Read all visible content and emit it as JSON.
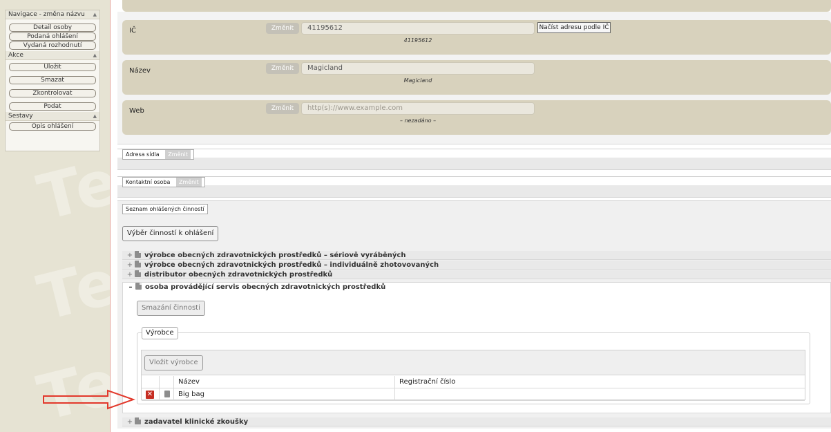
{
  "sidebar": {
    "navigation": {
      "header": "Navigace - změna názvu",
      "items": [
        "Detail osoby",
        "Podaná ohlášení",
        "Vydaná rozhodnutí"
      ]
    },
    "actions": {
      "header": "Akce",
      "items": [
        "Uložit",
        "Smazat",
        "Zkontrolovat",
        "Podat"
      ]
    },
    "reports": {
      "header": "Sestavy",
      "items": [
        "Opis ohlášení"
      ]
    },
    "watermark": "Tes"
  },
  "fields": [
    {
      "label": "IČ",
      "change": "Změnit",
      "value": "41195612",
      "placeholder": "",
      "display": "41195612"
    },
    {
      "label": "Název",
      "change": "Změnit",
      "value": "Magicland",
      "placeholder": "",
      "display": "Magicland"
    },
    {
      "label": "Web",
      "change": "Změnit",
      "value": "",
      "placeholder": "http(s)://www.example.com",
      "display": "– nezadáno –"
    }
  ],
  "load_address_button": "Načíst adresu podle IČ",
  "sections": {
    "seat_address": {
      "legend": "Adresa sídla",
      "change": "Změnit"
    },
    "contact_person": {
      "legend": "Kontaktní osoba",
      "change": "Změnit"
    },
    "activities": {
      "legend": "Seznam ohlášených činností",
      "select_button": "Výběr činností k ohlášení",
      "items": [
        {
          "sign": "+",
          "label": "výrobce obecných zdravotnických prostředků – sériově vyráběných"
        },
        {
          "sign": "+",
          "label": "výrobce obecných zdravotnických prostředků – individuálně zhotovovaných"
        },
        {
          "sign": "+",
          "label": "distributor obecných zdravotnických prostředků"
        }
      ],
      "open_item": {
        "sign": "–",
        "label": "osoba provádějící servis obecných zdravotnických prostředků",
        "delete_button": "Smazání činnosti",
        "manufacturer": {
          "legend": "Výrobce",
          "insert_button": "Vložit výrobce",
          "columns": [
            "Název",
            "Registrační číslo"
          ],
          "rows": [
            {
              "name": "Big bag",
              "reg": ""
            }
          ]
        }
      },
      "last_item": {
        "sign": "+",
        "label": "zadavatel klinické zkoušky"
      }
    }
  },
  "colors": {
    "accent_arrow": "#e2382b",
    "field_bg": "#d8d2bd",
    "delete_icon": "#c62d22"
  }
}
